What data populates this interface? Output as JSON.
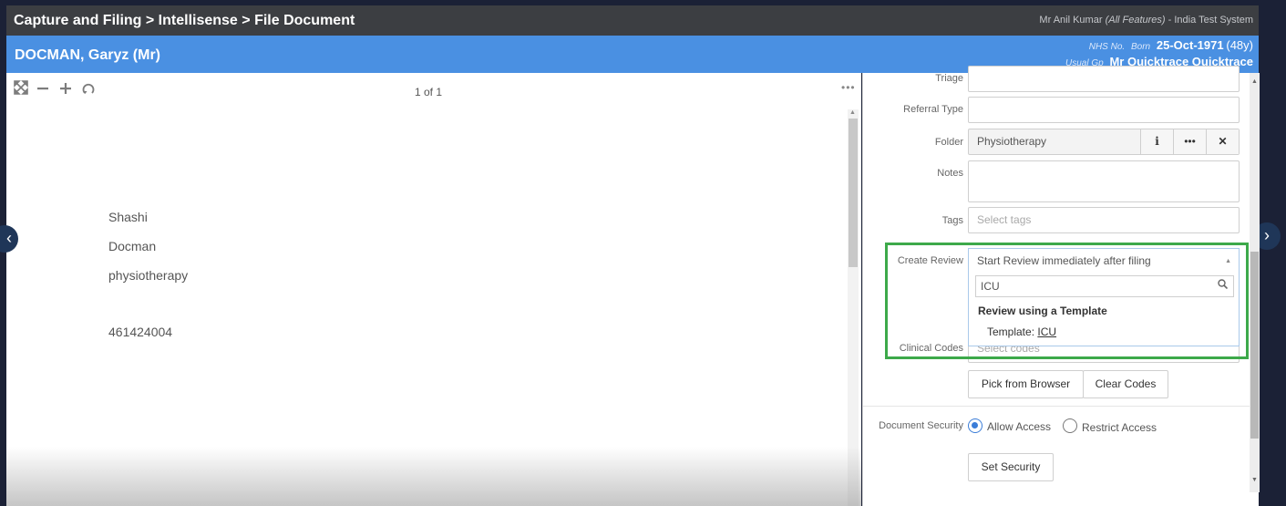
{
  "header": {
    "breadcrumb": "Capture and Filing > Intellisense > File Document",
    "user_name": "Mr Anil Kumar",
    "user_features": "(All Features)",
    "user_system": "- India Test System"
  },
  "patient": {
    "name": "DOCMAN, Garyz (Mr)",
    "nhs_label": "NHS No.",
    "born_label": "Born",
    "born_date": "25-Oct-1971",
    "age": "(48y)",
    "gp_label": "Usual Gp",
    "gp_name": "Mr Quicktrace Quicktrace"
  },
  "viewer": {
    "page_count": "1 of 1",
    "icons": [
      "fit-screen-icon",
      "zoom-out-icon",
      "zoom-in-icon",
      "rotate-icon",
      "more-options-icon"
    ],
    "lines": [
      "Shashi",
      "Docman",
      "physiotherapy",
      "461424004"
    ]
  },
  "form": {
    "triage_label": "Triage",
    "referral_type_label": "Referral Type",
    "folder_label": "Folder",
    "folder_value": "Physiotherapy",
    "notes_label": "Notes",
    "tags_label": "Tags",
    "tags_placeholder": "Select tags",
    "create_review_label": "Create Review",
    "create_review_value": "Start Review immediately after filing",
    "dropdown": {
      "search_value": "ICU",
      "group_label": "Review using a Template",
      "option_prefix": "Template:",
      "option_value": "ICU"
    },
    "clinical_codes_label": "Clinical Codes",
    "clinical_codes_placeholder": "Select codes",
    "pick_from_browser": "Pick from Browser",
    "clear_codes": "Clear Codes",
    "document_security_label": "Document Security",
    "allow_access": "Allow Access",
    "restrict_access": "Restrict Access",
    "set_security": "Set Security"
  },
  "colors": {
    "title_bar": "#3c3e42",
    "patient_bar": "#4a90e2",
    "highlight": "#3da94a"
  }
}
